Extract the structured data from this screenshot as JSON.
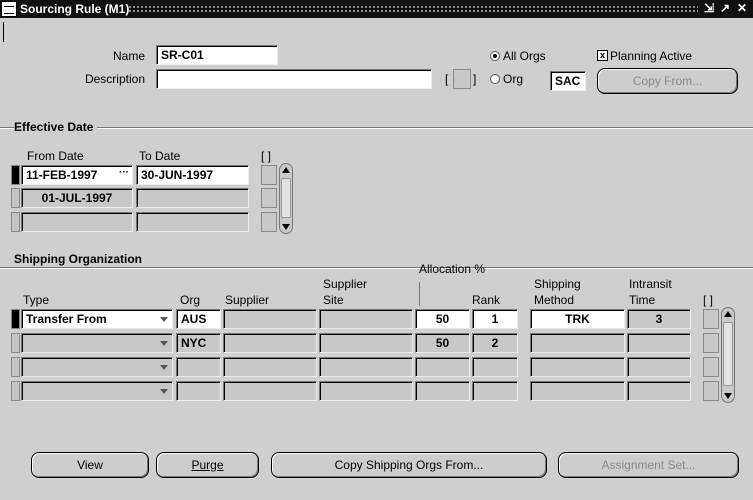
{
  "window": {
    "title": "Sourcing Rule (M1)",
    "controls": [
      "minimize-icon",
      "maximize-icon",
      "close-icon"
    ]
  },
  "header": {
    "name_label": "Name",
    "name_value": "SR-C01",
    "description_label": "Description",
    "description_value": "",
    "flex_brackets": "[ ]",
    "all_orgs_label": "All Orgs",
    "org_label": "Org",
    "org_value": "SAC",
    "planning_active_label": "Planning Active",
    "copy_from_label": "Copy From..."
  },
  "effective_date": {
    "section_title": "Effective Date",
    "from_date_label": "From Date",
    "to_date_label": "To Date",
    "flex_brackets": "[ ]",
    "rows": [
      {
        "from": "11-FEB-1997",
        "to": "30-JUN-1997"
      },
      {
        "from": "01-JUL-1997",
        "to": ""
      },
      {
        "from": "",
        "to": ""
      }
    ]
  },
  "shipping": {
    "section_title": "Shipping Organization",
    "col_type": "Type",
    "col_org": "Org",
    "col_supplier": "Supplier",
    "col_supplier_site_1": "Supplier",
    "col_supplier_site_2": "Site",
    "col_allocation": "Allocation %",
    "col_rank": "Rank",
    "col_ship_method_1": "Shipping",
    "col_ship_method_2": "Method",
    "col_intransit_1": "Intransit",
    "col_intransit_2": "Time",
    "flex_brackets": "[ ]",
    "rows": [
      {
        "type": "Transfer From",
        "org": "AUS",
        "supplier": "",
        "site": "",
        "allocation": "50",
        "rank": "1",
        "method": "TRK",
        "intransit": "3"
      },
      {
        "type": "",
        "org": "NYC",
        "supplier": "",
        "site": "",
        "allocation": "50",
        "rank": "2",
        "method": "",
        "intransit": ""
      },
      {
        "type": "",
        "org": "",
        "supplier": "",
        "site": "",
        "allocation": "",
        "rank": "",
        "method": "",
        "intransit": ""
      },
      {
        "type": "",
        "org": "",
        "supplier": "",
        "site": "",
        "allocation": "",
        "rank": "",
        "method": "",
        "intransit": ""
      }
    ]
  },
  "footer": {
    "view_label": "View",
    "purge_label": "Purge",
    "copy_shipping_label": "Copy Shipping Orgs From...",
    "assignment_set_label": "Assignment Set..."
  }
}
